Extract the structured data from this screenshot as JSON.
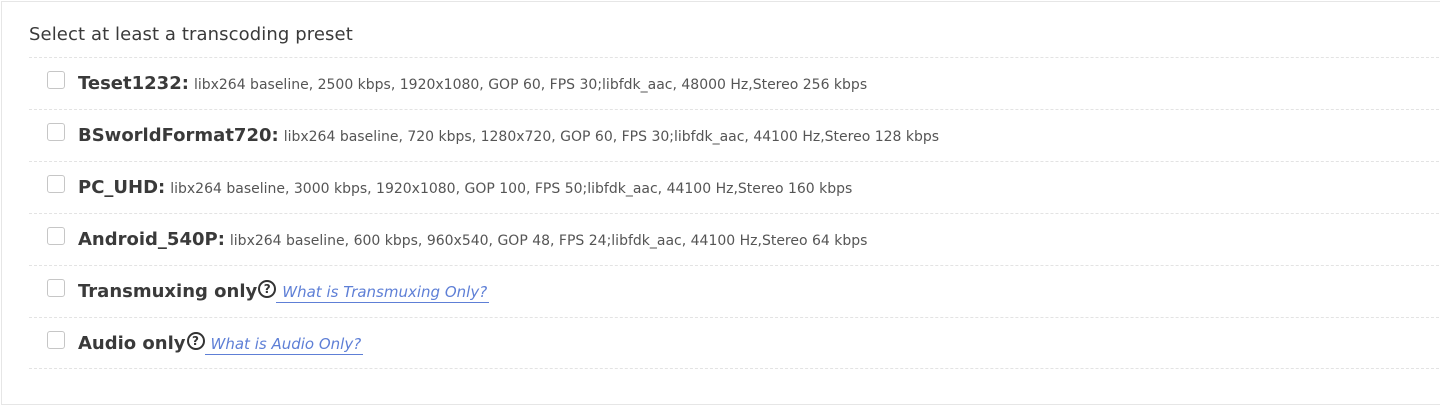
{
  "section": {
    "title": "Select at least a transcoding preset"
  },
  "presets": [
    {
      "name": "Teset1232",
      "colon": ":",
      "description": "libx264 baseline, 2500 kbps, 1920x1080, GOP 60, FPS 30;libfdk_aac, 48000 Hz,Stereo 256 kbps"
    },
    {
      "name": "BSworldFormat720",
      "colon": ":",
      "description": "libx264 baseline, 720 kbps, 1280x720, GOP 60, FPS 30;libfdk_aac, 44100 Hz,Stereo 128 kbps"
    },
    {
      "name": "PC_UHD",
      "colon": ":",
      "description": "libx264 baseline, 3000 kbps, 1920x1080, GOP 100, FPS 50;libfdk_aac, 44100 Hz,Stereo 160 kbps"
    },
    {
      "name": "Android_540P",
      "colon": ":",
      "description": "libx264 baseline, 600 kbps, 960x540, GOP 48, FPS 24;libfdk_aac, 44100 Hz,Stereo 64 kbps"
    }
  ],
  "options": [
    {
      "name": "Transmuxing only",
      "help_glyph": "?",
      "help_link": "What is Transmuxing Only?"
    },
    {
      "name": "Audio only",
      "help_glyph": "?",
      "help_link": "What is Audio Only?"
    }
  ],
  "colors": {
    "link": "#5e7fd6",
    "border": "#e3e3e3",
    "checkbox_border": "#c6c6c6"
  },
  "icons": {
    "help": "question-circle-icon"
  }
}
